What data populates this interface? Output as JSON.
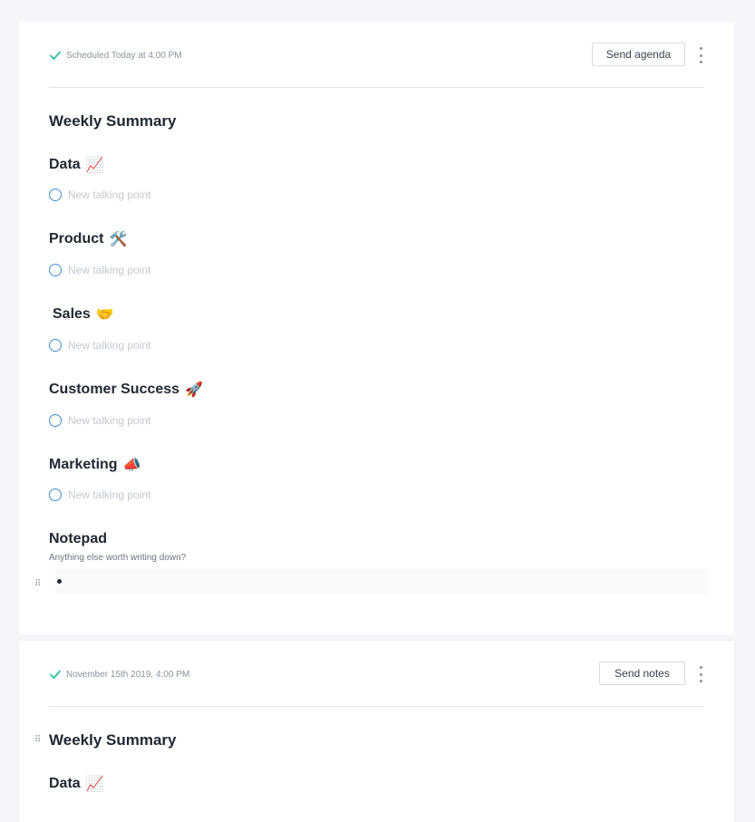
{
  "current_meeting": {
    "schedule": "Scheduled Today at 4:00 PM",
    "send_button": "Send agenda",
    "title": "Weekly Summary",
    "sections": [
      {
        "heading": "Data",
        "emoji": "📈",
        "placeholder": "New talking point"
      },
      {
        "heading": "Product",
        "emoji": "🛠️",
        "placeholder": "New talking point"
      },
      {
        "heading": "Sales",
        "emoji": "🤝",
        "placeholder": "New talking point"
      },
      {
        "heading": "Customer Success",
        "emoji": "🚀",
        "placeholder": "New talking point"
      },
      {
        "heading": "Marketing",
        "emoji": "📣",
        "placeholder": "New talking point"
      }
    ],
    "notepad": {
      "heading": "Notepad",
      "subtitle": "Anything else worth writing down?"
    }
  },
  "past_meeting": {
    "schedule": "November 15th 2019, 4:00 PM",
    "send_button": "Send notes",
    "title": "Weekly Summary",
    "first_section": {
      "heading": "Data",
      "emoji": "📈"
    }
  },
  "colors": {
    "accent": "#3a8fd8",
    "check": "#2bbfa4"
  }
}
